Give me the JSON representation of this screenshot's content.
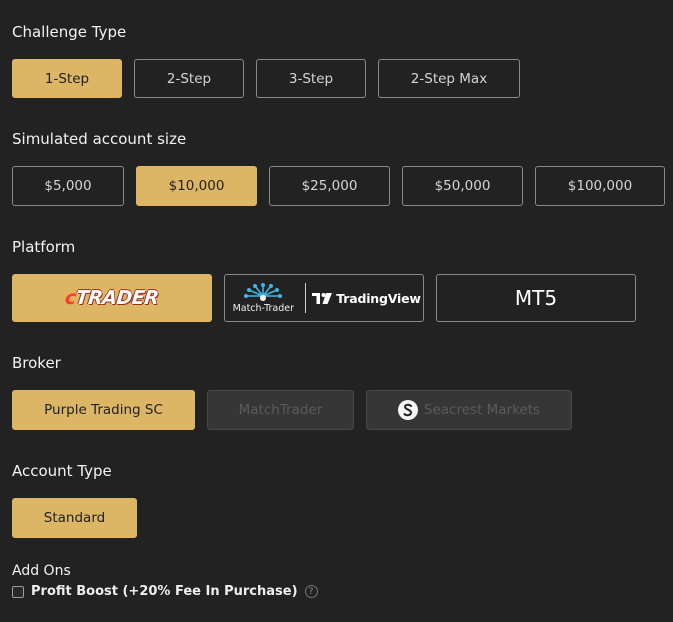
{
  "challenge_type": {
    "heading": "Challenge Type",
    "options": [
      "1-Step",
      "2-Step",
      "3-Step",
      "2-Step Max"
    ],
    "selected": "1-Step"
  },
  "account_size": {
    "heading": "Simulated account size",
    "options": [
      "$5,000",
      "$10,000",
      "$25,000",
      "$50,000",
      "$100,000"
    ],
    "selected": "$10,000"
  },
  "platform": {
    "heading": "Platform",
    "options": [
      {
        "id": "ctrader",
        "logo_text_c": "c",
        "logo_text_rest": "TRADER",
        "icon": "ctrader-logo"
      },
      {
        "id": "matchtrader-tradingview",
        "match_label": "Match-Trader",
        "tv_label": "TradingView",
        "icon": "matchtrader-tradingview-logo"
      },
      {
        "id": "mt5",
        "label": "MT5"
      }
    ],
    "selected": "ctrader"
  },
  "broker": {
    "heading": "Broker",
    "options": [
      {
        "label": "Purple Trading SC",
        "state": "selected"
      },
      {
        "label": "MatchTrader",
        "state": "disabled"
      },
      {
        "label": "Seacrest Markets",
        "state": "disabled",
        "icon": "seacrest-s-icon"
      }
    ]
  },
  "account_type": {
    "heading": "Account Type",
    "options": [
      "Standard"
    ],
    "selected": "Standard"
  },
  "add_ons": {
    "heading": "Add Ons",
    "items": [
      {
        "label": "Profit Boost (+20% Fee In Purchase)",
        "checked": false,
        "help_icon": "question-circle-icon"
      }
    ]
  },
  "colors": {
    "background": "#222222",
    "accent": "#dcb665",
    "border": "#8a8a8a",
    "disabled_bg": "#363636"
  }
}
